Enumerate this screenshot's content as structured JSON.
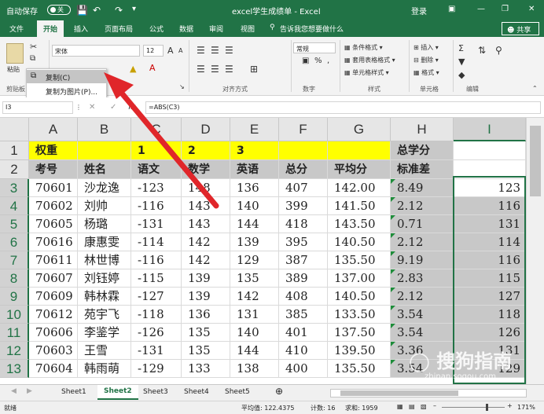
{
  "window": {
    "title": "excel学生成绩单 - Excel",
    "autosave": "自动保存",
    "autosave_state": "关",
    "login": "登录",
    "min": "—",
    "restore": "❐",
    "close": "✕"
  },
  "tabs": [
    "文件",
    "开始",
    "插入",
    "页面布局",
    "公式",
    "数据",
    "审阅",
    "视图"
  ],
  "tell_me": "告诉我您想要做什么",
  "share": "共享",
  "ribbon": {
    "paste": "粘贴",
    "clipboard_group": "剪贴板",
    "font_group": "字体",
    "font_name": "宋体",
    "font_size": "12",
    "align_group": "对齐方式",
    "number_format": "常规",
    "number_group": "数字",
    "percent": "%",
    "comma": ",",
    "conditional_format": "条件格式",
    "table_format": "套用表格格式",
    "cell_styles": "单元格样式",
    "styles_group": "样式",
    "insert": "插入",
    "delete": "删除",
    "format": "格式",
    "cells_group": "单元格",
    "editing_group": "编辑"
  },
  "copy_menu": {
    "copy": "复制(C)",
    "copy_as_picture": "复制为图片(P)..."
  },
  "formula_bar": {
    "name_box": "I3",
    "fx": "fx",
    "formula": "=ABS(C3)"
  },
  "columns": [
    "A",
    "B",
    "C",
    "D",
    "E",
    "F",
    "G",
    "H",
    "I"
  ],
  "rows": [
    [
      "权重",
      "",
      "1",
      "2",
      "3",
      "",
      "",
      "总学分",
      ""
    ],
    [
      "考号",
      "姓名",
      "语文",
      "数学",
      "英语",
      "总分",
      "平均分",
      "标准差",
      ""
    ],
    [
      "70601",
      "沙龙逸",
      "-123",
      "148",
      "136",
      "407",
      "142.00",
      "8.49",
      "123"
    ],
    [
      "70602",
      "刘帅",
      "-116",
      "143",
      "140",
      "399",
      "141.50",
      "2.12",
      "116"
    ],
    [
      "70605",
      "杨璐",
      "-131",
      "143",
      "144",
      "418",
      "143.50",
      "0.71",
      "131"
    ],
    [
      "70616",
      "康惠雯",
      "-114",
      "142",
      "139",
      "395",
      "140.50",
      "2.12",
      "114"
    ],
    [
      "70611",
      "林世博",
      "-116",
      "142",
      "129",
      "387",
      "135.50",
      "9.19",
      "116"
    ],
    [
      "70607",
      "刘钰婷",
      "-115",
      "139",
      "135",
      "389",
      "137.00",
      "2.83",
      "115"
    ],
    [
      "70609",
      "韩林霖",
      "-127",
      "139",
      "142",
      "408",
      "140.50",
      "2.12",
      "127"
    ],
    [
      "70612",
      "苑宇飞",
      "-118",
      "136",
      "131",
      "385",
      "133.50",
      "3.54",
      "118"
    ],
    [
      "70606",
      "李鉴学",
      "-126",
      "135",
      "140",
      "401",
      "137.50",
      "3.54",
      "126"
    ],
    [
      "70603",
      "王雪",
      "-131",
      "135",
      "144",
      "410",
      "139.50",
      "3.36",
      "131"
    ],
    [
      "70604",
      "韩雨萌",
      "-129",
      "133",
      "138",
      "400",
      "135.50",
      "3.54",
      "129"
    ]
  ],
  "sheets": [
    "Sheet1",
    "Sheet2",
    "Sheet3",
    "Sheet4",
    "Sheet5"
  ],
  "active_sheet": "Sheet2",
  "status": {
    "mode": "就绪",
    "average": "平均值: 122.4375",
    "count": "计数: 16",
    "sum": "求和: 1959",
    "zoom": "171%"
  },
  "watermark": {
    "text": "搜狗指南",
    "url": "zhinan.sogou.com"
  },
  "colors": {
    "excel_green": "#217346",
    "header_yellow": "#ffff00",
    "selection_gray": "#c8c8c8",
    "arrow_red": "#e0262a"
  }
}
